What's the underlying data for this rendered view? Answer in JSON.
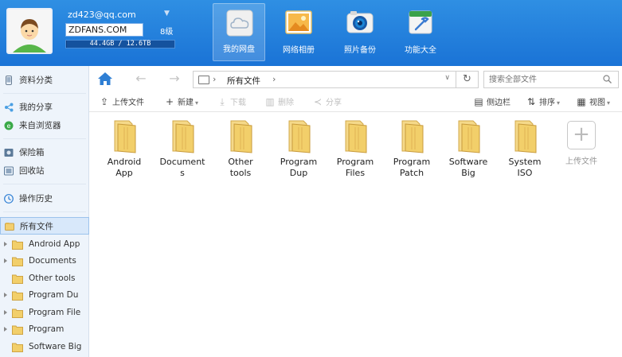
{
  "user": {
    "email": "zd423@qq.com",
    "nickname": "ZDFANS.COM",
    "level": "8级",
    "quota": "44.4GB / 12.6TB",
    "quota_used_fraction": 0.0035
  },
  "nav": [
    {
      "label": "我的网盘",
      "icon": "cloud-disk-icon",
      "active": true
    },
    {
      "label": "网络相册",
      "icon": "photo-album-icon",
      "active": false
    },
    {
      "label": "照片备份",
      "icon": "camera-icon",
      "active": false
    },
    {
      "label": "功能大全",
      "icon": "toolbox-icon",
      "active": false
    }
  ],
  "sidebar": {
    "items": [
      {
        "label": "资料分类",
        "icon": "phone-icon"
      },
      {
        "label": "我的分享",
        "icon": "share-icon"
      },
      {
        "label": "来自浏览器",
        "icon": "browser-icon"
      },
      {
        "label": "保险箱",
        "icon": "safe-icon"
      },
      {
        "label": "回收站",
        "icon": "recycle-bin-icon"
      },
      {
        "label": "操作历史",
        "icon": "history-icon"
      },
      {
        "label": "所有文件",
        "icon": "all-files-icon"
      }
    ],
    "tree": [
      {
        "label": "Android App",
        "expandable": true
      },
      {
        "label": "Documents",
        "expandable": true
      },
      {
        "label": "Other tools",
        "expandable": false
      },
      {
        "label": "Program Du",
        "expandable": true
      },
      {
        "label": "Program File",
        "expandable": true
      },
      {
        "label": "Program",
        "expandable": true
      },
      {
        "label": "Software Big",
        "expandable": false
      }
    ]
  },
  "address": {
    "path": "所有文件",
    "search_placeholder": "搜索全部文件"
  },
  "toolbar": {
    "upload": "上传文件",
    "new": "新建",
    "download": "下载",
    "delete": "删除",
    "share": "分享",
    "sidebar": "侧边栏",
    "sort": "排序",
    "view": "视图"
  },
  "files": [
    {
      "line1": "Android",
      "line2": "App"
    },
    {
      "line1": "Document",
      "line2": "s"
    },
    {
      "line1": "Other",
      "line2": "tools"
    },
    {
      "line1": "Program",
      "line2": "Dup"
    },
    {
      "line1": "Program",
      "line2": "Files"
    },
    {
      "line1": "Program",
      "line2": "Patch"
    },
    {
      "line1": "Software",
      "line2": "Big"
    },
    {
      "line1": "System",
      "line2": "ISO"
    }
  ],
  "upload_tile": {
    "plus": "+",
    "label": "上传文件"
  },
  "colors": {
    "header": "#1a73d6",
    "sidebar": "#eef4fb",
    "selected": "#d8e8fa",
    "folder": "#f2cf6a"
  }
}
